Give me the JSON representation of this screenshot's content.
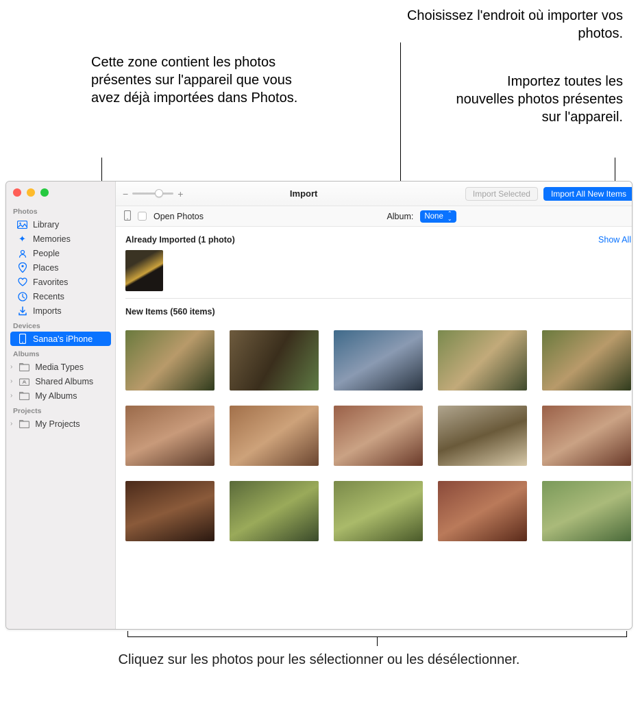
{
  "callouts": {
    "top_left": "Cette zone contient les photos présentes sur l'appareil que vous avez déjà importées dans Photos.",
    "top_right_1": "Choisissez l'endroit où importer vos photos.",
    "top_right_2": "Importez toutes les nouvelles photos présentes sur l'appareil.",
    "bottom": "Cliquez sur les photos pour les sélectionner ou les désélectionner."
  },
  "toolbar": {
    "title": "Import",
    "import_selected": "Import Selected",
    "import_all": "Import All New Items"
  },
  "subbar": {
    "open_photos": "Open Photos",
    "album_label": "Album:",
    "album_value": "None"
  },
  "sidebar": {
    "photos_header": "Photos",
    "library": "Library",
    "memories": "Memories",
    "people": "People",
    "places": "Places",
    "favorites": "Favorites",
    "recents": "Recents",
    "imports": "Imports",
    "devices_header": "Devices",
    "device_name": "Sanaa's iPhone",
    "albums_header": "Albums",
    "media_types": "Media Types",
    "shared_albums": "Shared Albums",
    "my_albums": "My Albums",
    "projects_header": "Projects",
    "my_projects": "My Projects"
  },
  "sections": {
    "already_imported": "Already Imported (1 photo)",
    "show_all": "Show All",
    "new_items": "New Items (560 items)"
  }
}
